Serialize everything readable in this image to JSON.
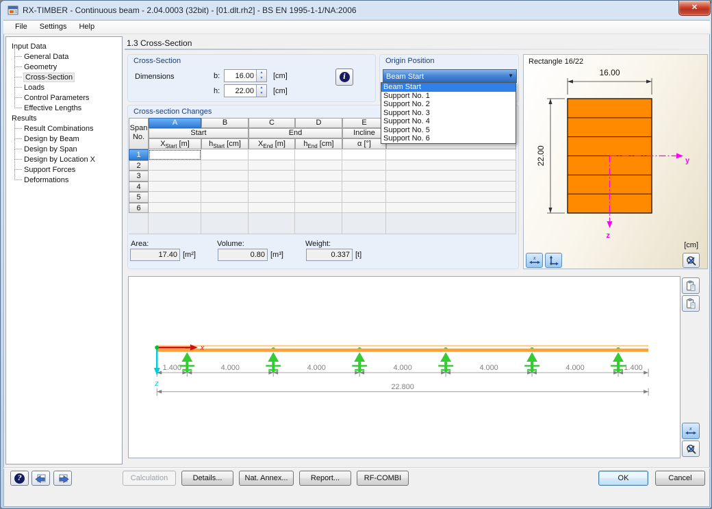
{
  "window": {
    "title": "RX-TIMBER - Continuous beam - 2.04.0003 (32bit) - [01.dlt.rh2] - BS EN 1995-1-1/NA:2006"
  },
  "icons": {
    "close": "✕",
    "combo_arrow": "▼",
    "spin_up": "▲",
    "spin_down": "▼",
    "help": "?",
    "info": "i"
  },
  "menu": {
    "items": [
      "File",
      "Settings",
      "Help"
    ]
  },
  "sidebar": {
    "sections": [
      {
        "label": "Input Data",
        "items": [
          "General Data",
          "Geometry",
          "Cross-Section",
          "Loads",
          "Control Parameters",
          "Effective Lengths"
        ],
        "selected_index": 2
      },
      {
        "label": "Results",
        "items": [
          "Result Combinations",
          "Design by Beam",
          "Design by Span",
          "Design by Location X",
          "Support Forces",
          "Deformations"
        ],
        "selected_index": -1
      }
    ]
  },
  "page": {
    "title": "1.3 Cross-Section"
  },
  "cross_section": {
    "caption": "Cross-Section",
    "dimensions_label": "Dimensions",
    "fields": [
      {
        "label": "b:",
        "value": "16.00",
        "unit": "[cm]"
      },
      {
        "label": "h:",
        "value": "22.00",
        "unit": "[cm]"
      }
    ]
  },
  "origin_position": {
    "caption": "Origin Position",
    "selected": "Beam Start",
    "open": true,
    "options": [
      "Beam Start",
      "Support No. 1",
      "Support No. 2",
      "Support No. 3",
      "Support No. 4",
      "Support No. 5",
      "Support No. 6"
    ],
    "highlighted_index": 0
  },
  "changes_table": {
    "caption": "Cross-section Changes",
    "row_header": [
      "Span",
      "No."
    ],
    "column_letters": [
      "A",
      "B",
      "C",
      "D",
      "E"
    ],
    "selected_letter": "A",
    "group_headers": [
      {
        "label": "Start",
        "span": 2
      },
      {
        "label": "End",
        "span": 2
      },
      {
        "label": "Incline",
        "span": 1
      }
    ],
    "field_headers": [
      {
        "base": "X",
        "sub": "Start",
        "unit": "[m]"
      },
      {
        "base": "h",
        "sub": "Start",
        "unit": "[cm]"
      },
      {
        "base": "X",
        "sub": "End",
        "unit": "[m]"
      },
      {
        "base": "h",
        "sub": "End",
        "unit": "[cm]"
      },
      {
        "base": "α",
        "sub": "",
        "unit": "[°]"
      }
    ],
    "rows": [
      "1",
      "2",
      "3",
      "4",
      "5",
      "6"
    ],
    "selected_row": "1",
    "cell_values": []
  },
  "totals": [
    {
      "label": "Area:",
      "value": "17.40",
      "unit": "[m²]"
    },
    {
      "label": "Volume:",
      "value": "0.80",
      "unit": "[m³]"
    },
    {
      "label": "Weight:",
      "value": "0.337",
      "unit": "[t]"
    }
  ],
  "preview": {
    "title": "Rectangle 16/22",
    "width_label": "16.00",
    "height_label": "22.00",
    "unit_label": "[cm]",
    "axis_y_label": "y",
    "axis_z_label": "z",
    "lamella_count": 6,
    "fill_color": "#FF8A00",
    "axis_color": "#FF00FF"
  },
  "beam": {
    "segments": [
      {
        "label": "1.400",
        "value": 1.4
      },
      {
        "label": "4.000",
        "value": 4.0
      },
      {
        "label": "4.000",
        "value": 4.0
      },
      {
        "label": "4.000",
        "value": 4.0
      },
      {
        "label": "4.000",
        "value": 4.0
      },
      {
        "label": "4.000",
        "value": 4.0
      },
      {
        "label": "1.400",
        "value": 1.4
      }
    ],
    "total_label": "22.800",
    "total_value": 22.8,
    "support_count": 6,
    "axis_x_label": "x",
    "axis_z_label": "z",
    "beam_color": "#FFA033",
    "beam_color_light": "#FFC880",
    "support_color": "#33CC33",
    "axis_x_color": "#CC1111",
    "axis_z_color": "#00CCDD"
  },
  "footer": {
    "buttons": [
      {
        "label": "Calculation",
        "enabled": false
      },
      {
        "label": "Details...",
        "enabled": true
      },
      {
        "label": "Nat. Annex...",
        "enabled": true
      },
      {
        "label": "Report...",
        "enabled": true
      },
      {
        "label": "RF-COMBI",
        "enabled": true
      }
    ],
    "ok": "OK",
    "cancel": "Cancel"
  },
  "colors": {
    "selection_blue": "#2F80E8",
    "group_caption": "#1B3C7A",
    "dimension_gray": "#808080"
  }
}
